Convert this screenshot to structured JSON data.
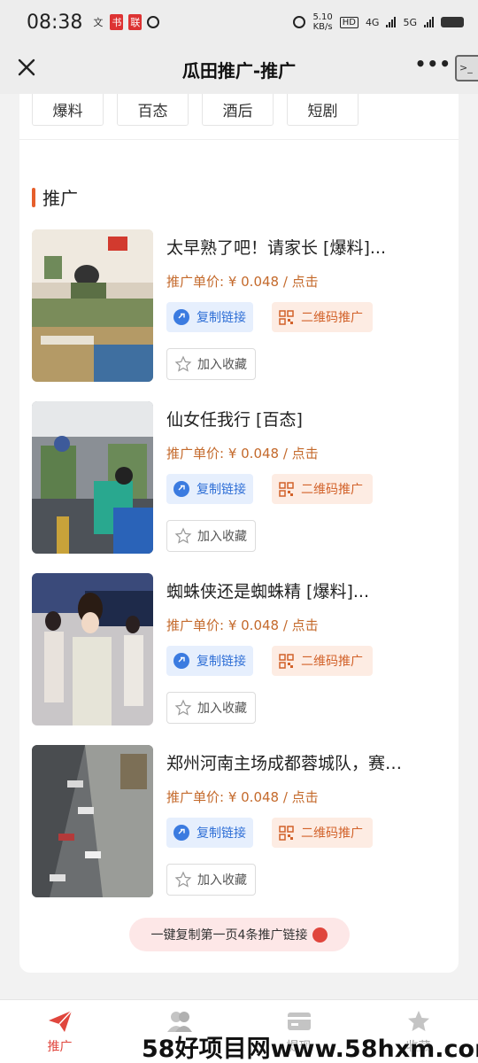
{
  "status": {
    "time": "08:38",
    "left_icons": [
      "文",
      "书",
      "联"
    ],
    "speed_top": "5.10",
    "speed_bottom": "KB/s",
    "hd": "HD",
    "net1": "4G",
    "net2": "5G"
  },
  "nav": {
    "title": "瓜田推广-推广",
    "more": "•••"
  },
  "categories": [
    "爆料",
    "百态",
    "酒后",
    "短剧"
  ],
  "section": {
    "title": "推广"
  },
  "items": [
    {
      "title": "太早熟了吧！请家长 [爆料]...",
      "price": "推广单价: ¥ 0.048 / 点击",
      "copy_label": "复制链接",
      "qr_label": "二维码推广",
      "fav_label": "加入收藏"
    },
    {
      "title": "仙女任我行 [百态]",
      "price": "推广单价: ¥ 0.048 / 点击",
      "copy_label": "复制链接",
      "qr_label": "二维码推广",
      "fav_label": "加入收藏"
    },
    {
      "title": "蜘蛛侠还是蜘蛛精 [爆料]...",
      "price": "推广单价: ¥ 0.048 / 点击",
      "copy_label": "复制链接",
      "qr_label": "二维码推广",
      "fav_label": "加入收藏"
    },
    {
      "title": "郑州河南主场成都蓉城队，赛…",
      "price": "推广单价: ¥ 0.048 / 点击",
      "copy_label": "复制链接",
      "qr_label": "二维码推广",
      "fav_label": "加入收藏"
    }
  ],
  "copy_all_label": "一键复制第一页4条推广链接",
  "tabs": [
    {
      "label": "推广",
      "icon": "paper-plane-icon",
      "active": true
    },
    {
      "label": "",
      "icon": "users-icon",
      "active": false
    },
    {
      "label": "提现",
      "icon": "wallet-icon",
      "active": false
    },
    {
      "label": "收藏",
      "icon": "star-icon",
      "active": false
    }
  ],
  "watermark": "58好项目网www.58hxm.com",
  "colors": {
    "accent": "#e65f2c",
    "price": "#c46a2c",
    "copy_blue": "#2f6fd6",
    "qr_orange": "#d2622a",
    "tab_active": "#e0463d"
  }
}
